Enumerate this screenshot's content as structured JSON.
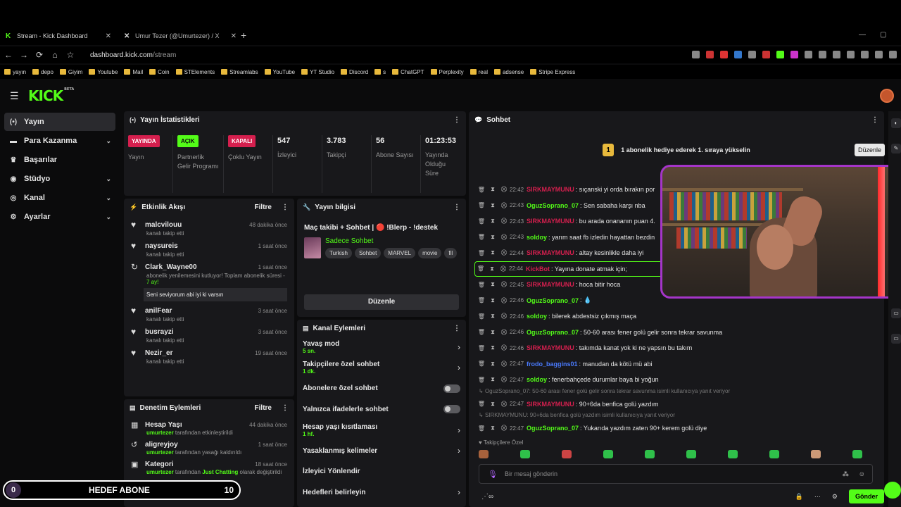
{
  "browser": {
    "tabs": [
      {
        "title": "Stream - Kick Dashboard",
        "favicon": "kick-icon"
      },
      {
        "title": "Umur Tezer (@Umurtezer) / X",
        "favicon": "x-icon"
      }
    ],
    "url_host": "dashboard.kick.com",
    "url_path": "/stream",
    "bookmarks": [
      "yayın",
      "depo",
      "Giyim",
      "Youtube",
      "Mail",
      "Coin",
      "STElements",
      "Streamlabs",
      "YouTube",
      "YT Studio",
      "Discord",
      "s",
      "ChatGPT",
      "Perplexity",
      "real",
      "adsense",
      "Stripe Express"
    ]
  },
  "sidebar": {
    "items": [
      {
        "label": "Yayın",
        "icon": "broadcast-icon",
        "active": true,
        "chevron": false
      },
      {
        "label": "Para Kazanma",
        "icon": "money-icon",
        "active": false,
        "chevron": true
      },
      {
        "label": "Başarılar",
        "icon": "trophy-icon",
        "active": false,
        "chevron": false
      },
      {
        "label": "Stüdyo",
        "icon": "studio-icon",
        "active": false,
        "chevron": true
      },
      {
        "label": "Kanal",
        "icon": "channel-icon",
        "active": false,
        "chevron": true
      },
      {
        "label": "Ayarlar",
        "icon": "gear-icon",
        "active": false,
        "chevron": true
      }
    ]
  },
  "stats": {
    "title": "Yayın İstatistikleri",
    "cells": [
      {
        "badge": "YAYINDA",
        "badge_color": "#d51f4e",
        "label": "Yayın"
      },
      {
        "badge": "AÇIK",
        "badge_color": "#53fc18",
        "label": "Partnerlik Gelir Programı"
      },
      {
        "badge": "KAPALI",
        "badge_color": "#d51f4e",
        "label": "Çoklu Yayın"
      },
      {
        "value": "547",
        "label": "İzleyici"
      },
      {
        "value": "3.783",
        "label": "Takipçi"
      },
      {
        "value": "56",
        "label": "Abone Sayısı"
      },
      {
        "value": "01:23:53",
        "label": "Yayında Olduğu Süre"
      }
    ]
  },
  "events": {
    "title": "Etkinlik Akışı",
    "filter": "Filtre",
    "items": [
      {
        "name": "malcvilouu",
        "time": "48 dakika önce",
        "desc": "kanalı takip etti",
        "type": "follow"
      },
      {
        "name": "naysureis",
        "time": "1 saat önce",
        "desc": "kanalı takip etti",
        "type": "follow"
      },
      {
        "name": "Clark_Wayne00",
        "time": "1 saat önce",
        "desc": "abonelik yenilemesini kutluyor! Toplam abonelik süresi -",
        "months": "7 ay!",
        "message": "Seni seviyorum abi iyi ki varsın",
        "type": "resub"
      },
      {
        "name": "anilFear",
        "time": "3 saat önce",
        "desc": "kanalı takip etti",
        "type": "follow"
      },
      {
        "name": "busrayzi",
        "time": "3 saat önce",
        "desc": "kanalı takip etti",
        "type": "follow"
      },
      {
        "name": "Nezir_er",
        "time": "19 saat önce",
        "desc": "kanalı takip etti",
        "type": "follow"
      }
    ]
  },
  "moderation": {
    "title": "Denetim Eylemleri",
    "filter": "Filtre",
    "items": [
      {
        "name": "Hesap Yaşı",
        "time": "44 dakika önce",
        "by": "umurtezer",
        "action": "tarafından etkinleştirildi",
        "icon": "calendar-icon"
      },
      {
        "name": "aligreyjoy",
        "time": "1 saat önce",
        "by": "umurtezer",
        "action": "tarafından yasağı kaldırıldı",
        "icon": "undo-icon"
      },
      {
        "name": "Kategori",
        "time": "18 saat önce",
        "by": "umurtezer",
        "action": "tarafından",
        "extra": "Just Chatting",
        "action2": "olarak değiştirildi",
        "icon": "category-icon"
      }
    ]
  },
  "goal": {
    "current": "0",
    "label": "HEDEF ABONE",
    "target": "10"
  },
  "stream_info": {
    "title": "Yayın bilgisi",
    "stream_title": "Maç takibi + Sohbet | 🔴 !Blerp - !destek",
    "category": "Sadece Sohbet",
    "tags": [
      "Turkish",
      "Sohbet",
      "MARVEL",
      "movie",
      "fil"
    ],
    "edit_button": "Düzenle"
  },
  "channel_actions": {
    "title": "Kanal Eylemleri",
    "rows": [
      {
        "label": "Yavaş mod",
        "sub": "5 sn.",
        "control": "chevron"
      },
      {
        "label": "Takipçilere özel sohbet",
        "sub": "1 dk.",
        "control": "chevron"
      },
      {
        "label": "Abonelere özel sohbet",
        "sub": "",
        "control": "toggle"
      },
      {
        "label": "Yalnızca ifadelerle sohbet",
        "sub": "",
        "control": "toggle"
      },
      {
        "label": "Hesap yaşı kısıtlaması",
        "sub": "1 hf.",
        "control": "chevron"
      },
      {
        "label": "Yasaklanmış kelimeler",
        "sub": "",
        "control": "chevron"
      },
      {
        "label": "İzleyici Yönlendir",
        "sub": "",
        "control": "none"
      },
      {
        "label": "Hedefleri belirleyin",
        "sub": "",
        "control": "chevron"
      }
    ]
  },
  "chat": {
    "title": "Sohbet",
    "pinned_rank": "1",
    "pinned_text": "1 abonelik hediye ederek 1. sıraya yükselin",
    "messages": [
      {
        "time": "22:42",
        "user": "SIRKMAYMUNU",
        "color": "#d51f4e",
        "text": ": sıçanski yi orda bırakın por"
      },
      {
        "time": "22:43",
        "user": "OguzSoprano_07",
        "color": "#53fc18",
        "text": ": Sen sabaha karşı nba"
      },
      {
        "time": "22:43",
        "user": "SIRKMAYMUNU",
        "color": "#d51f4e",
        "text": ": bu arada onananın puan 4."
      },
      {
        "time": "22:43",
        "user": "soldoy",
        "color": "#53fc18",
        "text": ": yarım saat fb izledin hayattan bezdin"
      },
      {
        "time": "22:44",
        "user": "SIRKMAYMUNU",
        "color": "#d51f4e",
        "text": ": altay kesinlikle daha iyi"
      },
      {
        "time": "22:44",
        "user": "KickBot",
        "color": "#d51f4e",
        "text": ": Yayına donate atmak için;",
        "highlight": true
      },
      {
        "time": "22:45",
        "user": "SIRKMAYMUNU",
        "color": "#d51f4e",
        "text": ": hoca bitir hoca"
      },
      {
        "time": "22:46",
        "user": "OguzSoprano_07",
        "color": "#53fc18",
        "text": ": 💧"
      },
      {
        "time": "22:46",
        "user": "soldoy",
        "color": "#53fc18",
        "text": ": bilerek abdestsiz çıkmış maça"
      },
      {
        "time": "22:46",
        "user": "OguzSoprano_07",
        "color": "#53fc18",
        "text": ": 50-60 arası fener golü gelir sonra tekrar savunma"
      },
      {
        "time": "22:46",
        "user": "SIRKMAYMUNU",
        "color": "#d51f4e",
        "text": ": takımda kanat yok ki ne yapsın bu takım"
      },
      {
        "time": "22:47",
        "user": "frodo_baggins01",
        "color": "#4a7bff",
        "text": ": manudan da kötü mü abi"
      },
      {
        "time": "22:47",
        "user": "soldoy",
        "color": "#53fc18",
        "text": ": fenerbahçede durumlar baya bi yoğun"
      },
      {
        "reply": "OguzSoprano_07: 50-60 arası fener golü gelir sonra tekrar savunma isimli kullanıcıya yanıt veriyor",
        "time": "22:47",
        "user": "SIRKMAYMUNU",
        "color": "#d51f4e",
        "text": ": 90+6da benfica golü yazdım"
      },
      {
        "reply": "SIRKMAYMUNU: 90+6da benfica golü yazdım isimli kullanıcıya yanıt veriyor",
        "time": "22:47",
        "user": "OguzSoprano_07",
        "color": "#53fc18",
        "text": ": Yukarıda yazdım zaten 90+ kerem golü diye"
      }
    ],
    "follower_label": "Takipçilere Özel",
    "input_placeholder": "Bir mesaj gönderin",
    "send_label": "Gönder"
  },
  "tooltip": "Düzenle"
}
